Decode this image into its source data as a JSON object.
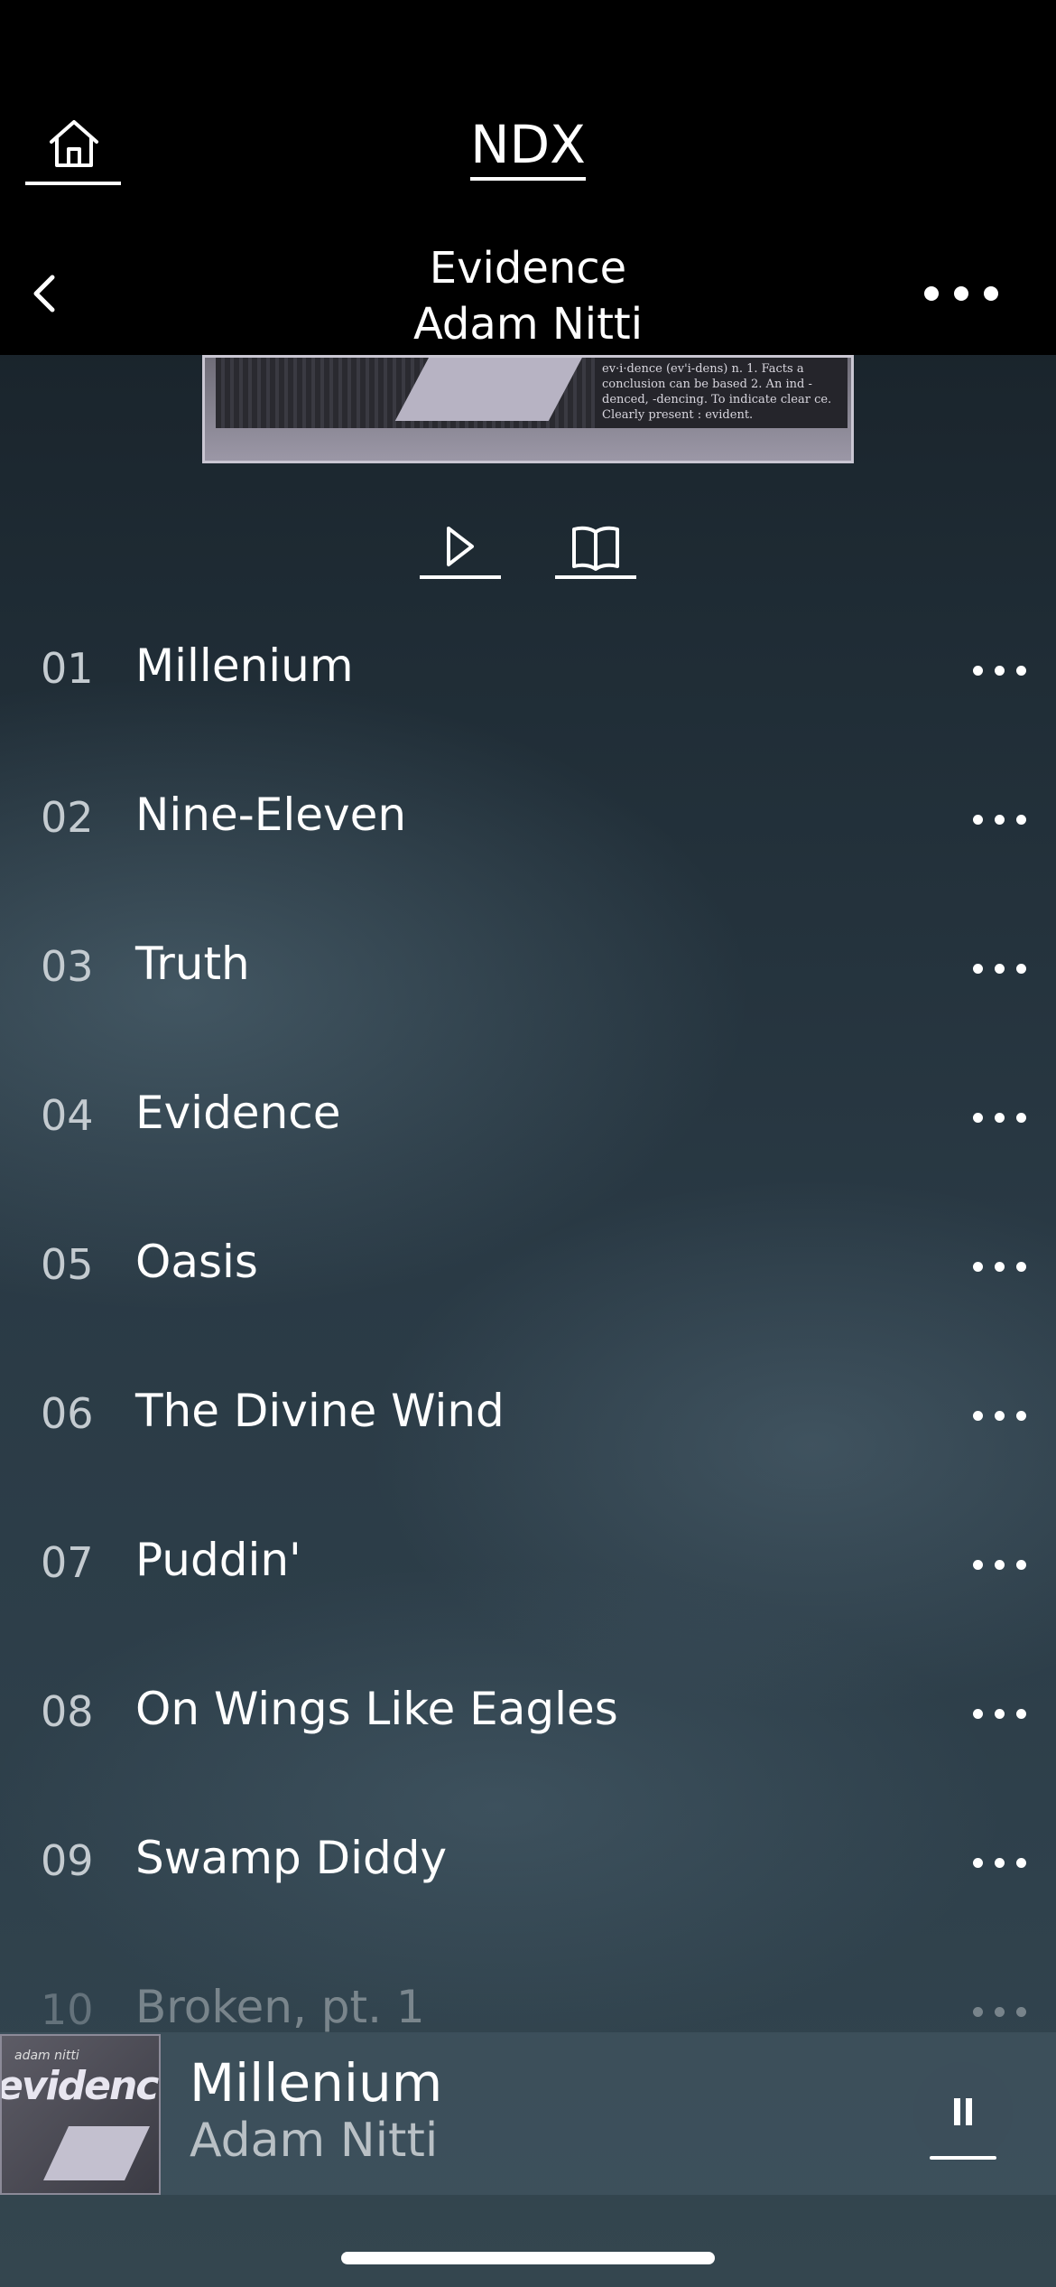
{
  "app": {
    "title": "NDX"
  },
  "album": {
    "title": "Evidence",
    "artist": "Adam Nitti"
  },
  "cover_peek_text": "ev·i·dence (ev'i-dens) n. 1. Facts a conclusion can be based 2. An ind -denced, -dencing. To indicate clear ce. Clearly present : evident.",
  "actions": {
    "play_icon": "play-icon",
    "info_icon": "book-icon"
  },
  "tracks": [
    {
      "number": "01",
      "title": "Millenium"
    },
    {
      "number": "02",
      "title": "Nine-Eleven"
    },
    {
      "number": "03",
      "title": "Truth"
    },
    {
      "number": "04",
      "title": "Evidence"
    },
    {
      "number": "05",
      "title": "Oasis"
    },
    {
      "number": "06",
      "title": "The Divine Wind"
    },
    {
      "number": "07",
      "title": "Puddin'"
    },
    {
      "number": "08",
      "title": "On Wings Like Eagles"
    },
    {
      "number": "09",
      "title": "Swamp Diddy"
    },
    {
      "number": "10",
      "title": "Broken, pt. 1"
    }
  ],
  "now_playing": {
    "title": "Millenium",
    "artist": "Adam Nitti",
    "art_small_text": "adam nitti",
    "art_logo": "evidence",
    "state_icon": "pause-icon"
  }
}
